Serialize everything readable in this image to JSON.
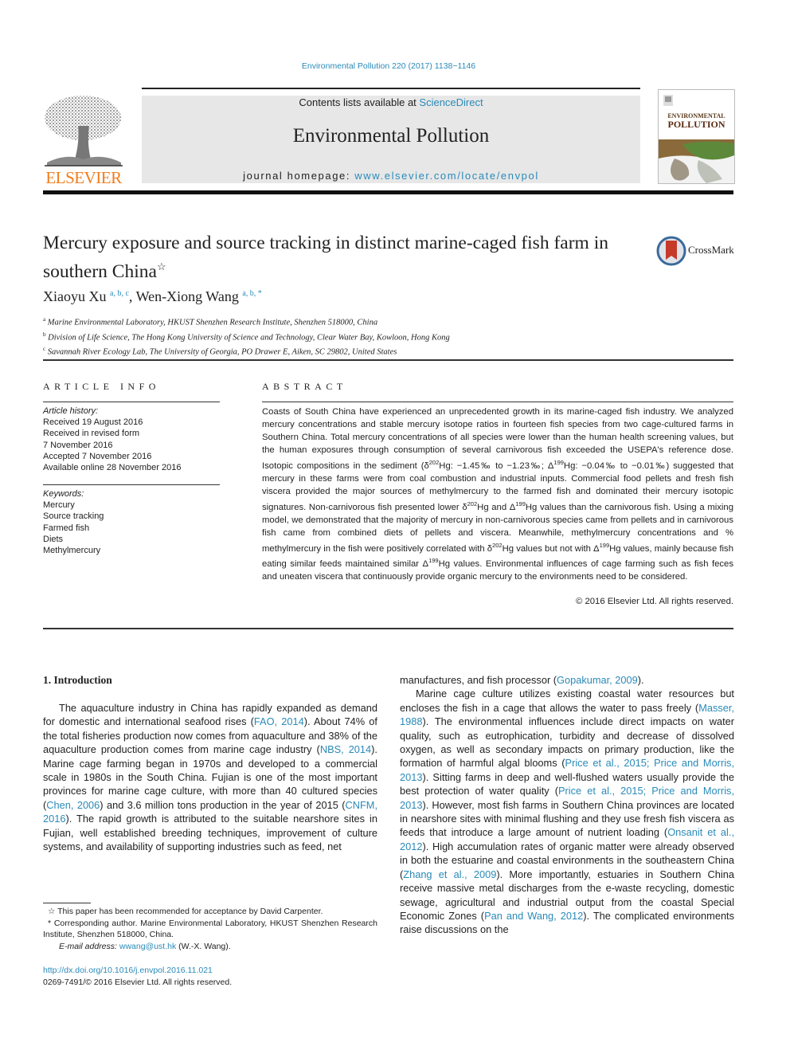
{
  "header": {
    "journal_ref": "Environmental Pollution 220 (2017) 1138−1146",
    "contents_prefix": "Contents lists available at ",
    "contents_link": "ScienceDirect",
    "journal_name": "Environmental Pollution",
    "homepage_prefix": "journal homepage: ",
    "homepage_link": "www.elsevier.com/locate/envpol",
    "publisher_logo_text": "ELSEVIER",
    "cover_title_line1": "ENVIRONMENTAL",
    "cover_title_line2": "POLLUTION"
  },
  "article": {
    "title": "Mercury exposure and source tracking in distinct marine-caged fish farm in southern China",
    "title_mark": "☆",
    "crossmark_label": "CrossMark",
    "authors": [
      {
        "name": "Xiaoyu Xu",
        "affil": "a, b, c"
      },
      {
        "name": "Wen-Xiong Wang",
        "affil": "a, b, *"
      }
    ],
    "affiliations": [
      {
        "key": "a",
        "text": "Marine Environmental Laboratory, HKUST Shenzhen Research Institute, Shenzhen 518000, China"
      },
      {
        "key": "b",
        "text": "Division of Life Science, The Hong Kong University of Science and Technology, Clear Water Bay, Kowloon, Hong Kong"
      },
      {
        "key": "c",
        "text": "Savannah River Ecology Lab, The University of Georgia, PO Drawer E, Aiken, SC 29802, United States"
      }
    ]
  },
  "article_info": {
    "heading": "ARTICLE INFO",
    "history_label": "Article history:",
    "history": [
      "Received 19 August 2016",
      "Received in revised form",
      "7 November 2016",
      "Accepted 7 November 2016",
      "Available online 28 November 2016"
    ],
    "keywords_label": "Keywords:",
    "keywords": [
      "Mercury",
      "Source tracking",
      "Farmed fish",
      "Diets",
      "Methylmercury"
    ]
  },
  "abstract": {
    "heading": "ABSTRACT",
    "segments": [
      "Coasts of South China have experienced an unprecedented growth in its marine-caged fish industry. We analyzed mercury concentrations and stable mercury isotope ratios in fourteen fish species from two cage-cultured farms in Southern China. Total mercury concentrations of all species were lower than the human health screening values, but the human exposures through consumption of several carnivorous fish exceeded the USEPA's reference dose. Isotopic compositions in the sediment (δ",
      "202",
      "Hg: −1.45‰ to −1.23‰; Δ",
      "199",
      "Hg: −0.04‰ to −0.01‰) suggested that mercury in these farms were from coal combustion and industrial inputs. Commercial food pellets and fresh fish viscera provided the major sources of methylmercury to the farmed fish and dominated their mercury isotopic signatures. Non-carnivorous fish presented lower δ",
      "202",
      "Hg and Δ",
      "199",
      "Hg values than the carnivorous fish. Using a mixing model, we demonstrated that the majority of mercury in non-carnivorous species came from pellets and in carnivorous fish came from combined diets of pellets and viscera. Meanwhile, methylmercury concentrations and % methylmercury in the fish were positively correlated with δ",
      "202",
      "Hg values but not with Δ",
      "199",
      "Hg values, mainly because fish eating similar feeds maintained similar Δ",
      "199",
      "Hg values. Environmental influences of cage farming such as fish feces and uneaten viscera that continuously provide organic mercury to the environments need to be considered."
    ],
    "copyright": "© 2016 Elsevier Ltd. All rights reserved."
  },
  "introduction": {
    "heading": "1.  Introduction",
    "left_col": [
      {
        "t": "The aquaculture industry in China has rapidly expanded as demand for domestic and international seafood rises ("
      },
      {
        "link": "FAO, 2014"
      },
      {
        "t": "). About 74% of the total fisheries production now comes from aquaculture and 38% of the aquaculture production comes from marine cage industry ("
      },
      {
        "link": "NBS, 2014"
      },
      {
        "t": "). Marine cage farming began in 1970s and developed to a commercial scale in 1980s in the South China. Fujian is one of the most important provinces for marine cage culture, with more than 40 cultured species ("
      },
      {
        "link": "Chen, 2006"
      },
      {
        "t": ") and 3.6 million tons production in the year of 2015 ("
      },
      {
        "link": "CNFM, 2016"
      },
      {
        "t": "). The rapid growth is attributed to the suitable nearshore sites in Fujian, well established breeding techniques, improvement of culture systems, and availability of supporting industries such as feed, net"
      }
    ],
    "right_col_cont": [
      {
        "t": "manufactures, and fish processor ("
      },
      {
        "link": "Gopakumar, 2009"
      },
      {
        "t": ")."
      }
    ],
    "right_col_para": [
      {
        "t": "Marine cage culture utilizes existing coastal water resources but encloses the fish in a cage that allows the water to pass freely ("
      },
      {
        "link": "Masser, 1988"
      },
      {
        "t": "). The environmental influences include direct impacts on water quality, such as eutrophication, turbidity and decrease of dissolved oxygen, as well as secondary impacts on primary production, like the formation of harmful algal blooms ("
      },
      {
        "link": "Price et al., 2015; Price and Morris, 2013"
      },
      {
        "t": "). Sitting farms in deep and well-flushed waters usually provide the best protection of water quality ("
      },
      {
        "link": "Price et al., 2015; Price and Morris, 2013"
      },
      {
        "t": "). However, most fish farms in Southern China provinces are located in nearshore sites with minimal flushing and they use fresh fish viscera as feeds that introduce a large amount of nutrient loading ("
      },
      {
        "link": "Onsanit et al., 2012"
      },
      {
        "t": "). High accumulation rates of organic matter were already observed in both the estuarine and coastal environments in the southeastern China ("
      },
      {
        "link": "Zhang et al., 2009"
      },
      {
        "t": "). More importantly, estuaries in Southern China receive massive metal discharges from the e-waste recycling, domestic sewage, agricultural and industrial output from the coastal Special Economic Zones ("
      },
      {
        "link": "Pan and Wang, 2012"
      },
      {
        "t": "). The complicated environments raise discussions on the"
      }
    ]
  },
  "footnotes": {
    "star_note": "This paper has been recommended for acceptance by David Carpenter.",
    "corresponding_note": "Corresponding author. Marine Environmental Laboratory, HKUST Shenzhen Research Institute, Shenzhen 518000, China.",
    "email_label": "E-mail address: ",
    "email": "wwang@ust.hk",
    "email_suffix": " (W.-X. Wang).",
    "doi": "http://dx.doi.org/10.1016/j.envpol.2016.11.021",
    "issn_line": "0269-7491/© 2016 Elsevier Ltd. All rights reserved."
  },
  "colors": {
    "link": "#2a8ab8",
    "elsevier_orange": "#f07c1c",
    "masthead_bg": "#e7e7e7"
  }
}
